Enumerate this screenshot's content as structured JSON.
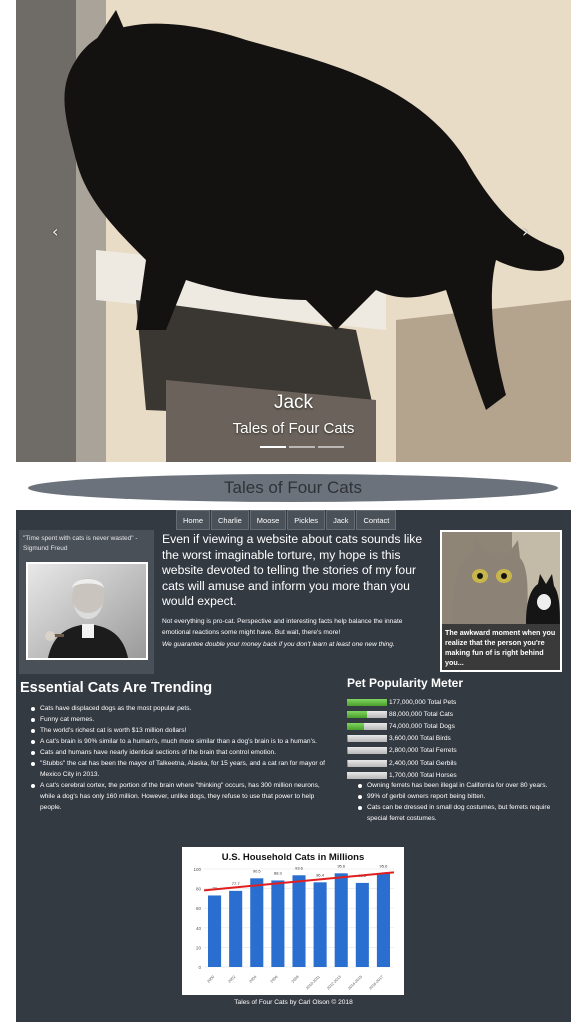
{
  "carousel": {
    "title": "Jack",
    "subtitle": "Tales of Four Cats",
    "prev_icon": "chevron-left-icon",
    "next_icon": "chevron-right-icon",
    "prev_glyph": "‹",
    "next_glyph": "›",
    "indicator_count": 3,
    "active_indicator": 0
  },
  "banner": {
    "title": "Tales of Four Cats"
  },
  "nav": {
    "items": [
      "Home",
      "Charlie",
      "Moose",
      "Pickles",
      "Jack",
      "Contact"
    ]
  },
  "quote": {
    "text": "\"Time spent with cats is never wasted\" - Sigmund Freud"
  },
  "intro": {
    "lead": "Even if viewing a website about cats sounds like the worst imaginable torture, my hope is this website devoted to telling the stories of my four cats will amuse and inform you more than you would expect.",
    "body": "Not everything is pro-cat. Perspective and interesting facts help balance the innate emotional reactions some might have. But wait, there's more!",
    "guarantee": "We guarantee double your money back if you don't learn at least one new thing."
  },
  "meme": {
    "caption": "The awkward moment when you realize that the person you're making fun of is right behind you..."
  },
  "trending": {
    "title": "Essential Cats Are Trending",
    "items": [
      "Cats have displaced dogs as the most popular pets.",
      "Funny cat memes.",
      "The world's richest cat is worth $13 million dollars!",
      "A cat's brain is 90% similar to a human's, much more similar than a dog's brain is to a human's.",
      "Cats and humans have nearly identical sections of the brain that control emotion.",
      "\"Stubbs\" the cat has been the mayor of Talkeetna, Alaska, for 15 years, and a cat ran for mayor of Mexico City in 2013.",
      "A cat's cerebral cortex, the portion of the brain where \"thinking\" occurs, has 300 million neurons, while a dog's has only 160 million. However, unlike dogs, they refuse to use that power to help people."
    ]
  },
  "meter": {
    "title": "Pet Popularity Meter",
    "rows": [
      {
        "label": "177,000,000 Total Pets",
        "fraction": 1.0
      },
      {
        "label": "88,000,000 Total Cats",
        "fraction": 0.5
      },
      {
        "label": "74,000,000 Total Dogs",
        "fraction": 0.42
      },
      {
        "label": "3,600,000 Total Birds",
        "fraction": 0.02
      },
      {
        "label": "2,800,000 Total Ferrets",
        "fraction": 0.016
      },
      {
        "label": "2,400,000 Total Gerbils",
        "fraction": 0.014
      },
      {
        "label": "1,700,000 Total Horses",
        "fraction": 0.01
      }
    ],
    "notes": [
      "Owning ferrets has been illegal in California for over 80 years.",
      "99% of gerbil owners report being bitten.",
      "Cats can be dressed in small dog costumes, but ferrets require special ferret costumes."
    ]
  },
  "chart_data": {
    "type": "bar",
    "title": "U.S. Household Cats in Millions",
    "categories": [
      "2000",
      "2002",
      "2004",
      "2006",
      "2008",
      "2010-2011",
      "2012-2013",
      "2014-2015",
      "2016-2017"
    ],
    "values": [
      73,
      77.7,
      90.5,
      88.3,
      93.6,
      86.4,
      95.6,
      85.8,
      95.6
    ],
    "yticks": [
      "0",
      "20",
      "40",
      "60",
      "80",
      "100"
    ],
    "ylim": [
      0,
      100
    ],
    "bar_color": "#2a6fcf",
    "trend_color": "#e02020"
  },
  "footer": {
    "text": "Tales of Four Cats by Carl Olson © 2018"
  }
}
